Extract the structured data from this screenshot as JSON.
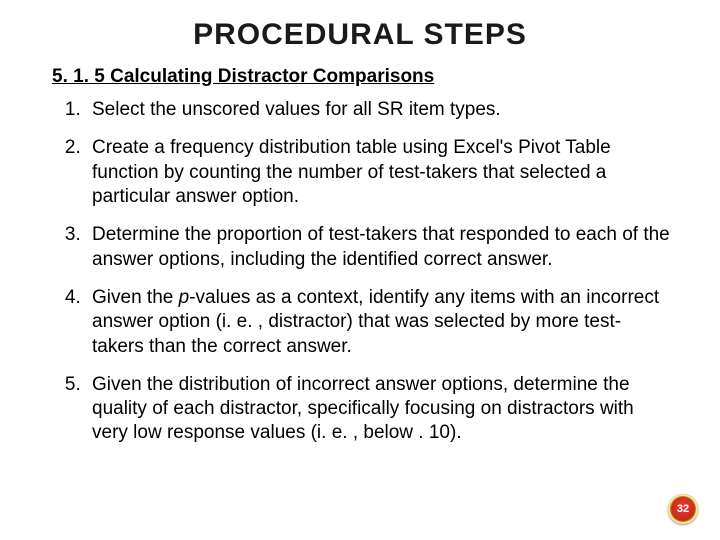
{
  "title": "PROCEDURAL STEPS",
  "subtitle": "5. 1. 5 Calculating Distractor Comparisons",
  "steps": [
    "Select the unscored values for all SR item types.",
    "Create a frequency distribution table using Excel's Pivot Table function by counting the number of test-takers that selected a particular answer option.",
    "Determine the proportion of test-takers that responded to each of the answer options, including the identified correct answer.",
    "Given the <span class=\"pval\">p</span>-values as a context, identify any items with an incorrect answer option (i. e. , distractor) that was selected by more test-takers than the correct answer.",
    "Given the distribution of incorrect answer options, determine the quality of each distractor, specifically focusing on distractors with very low response values (i. e. , below . 10)."
  ],
  "page_number": "32"
}
